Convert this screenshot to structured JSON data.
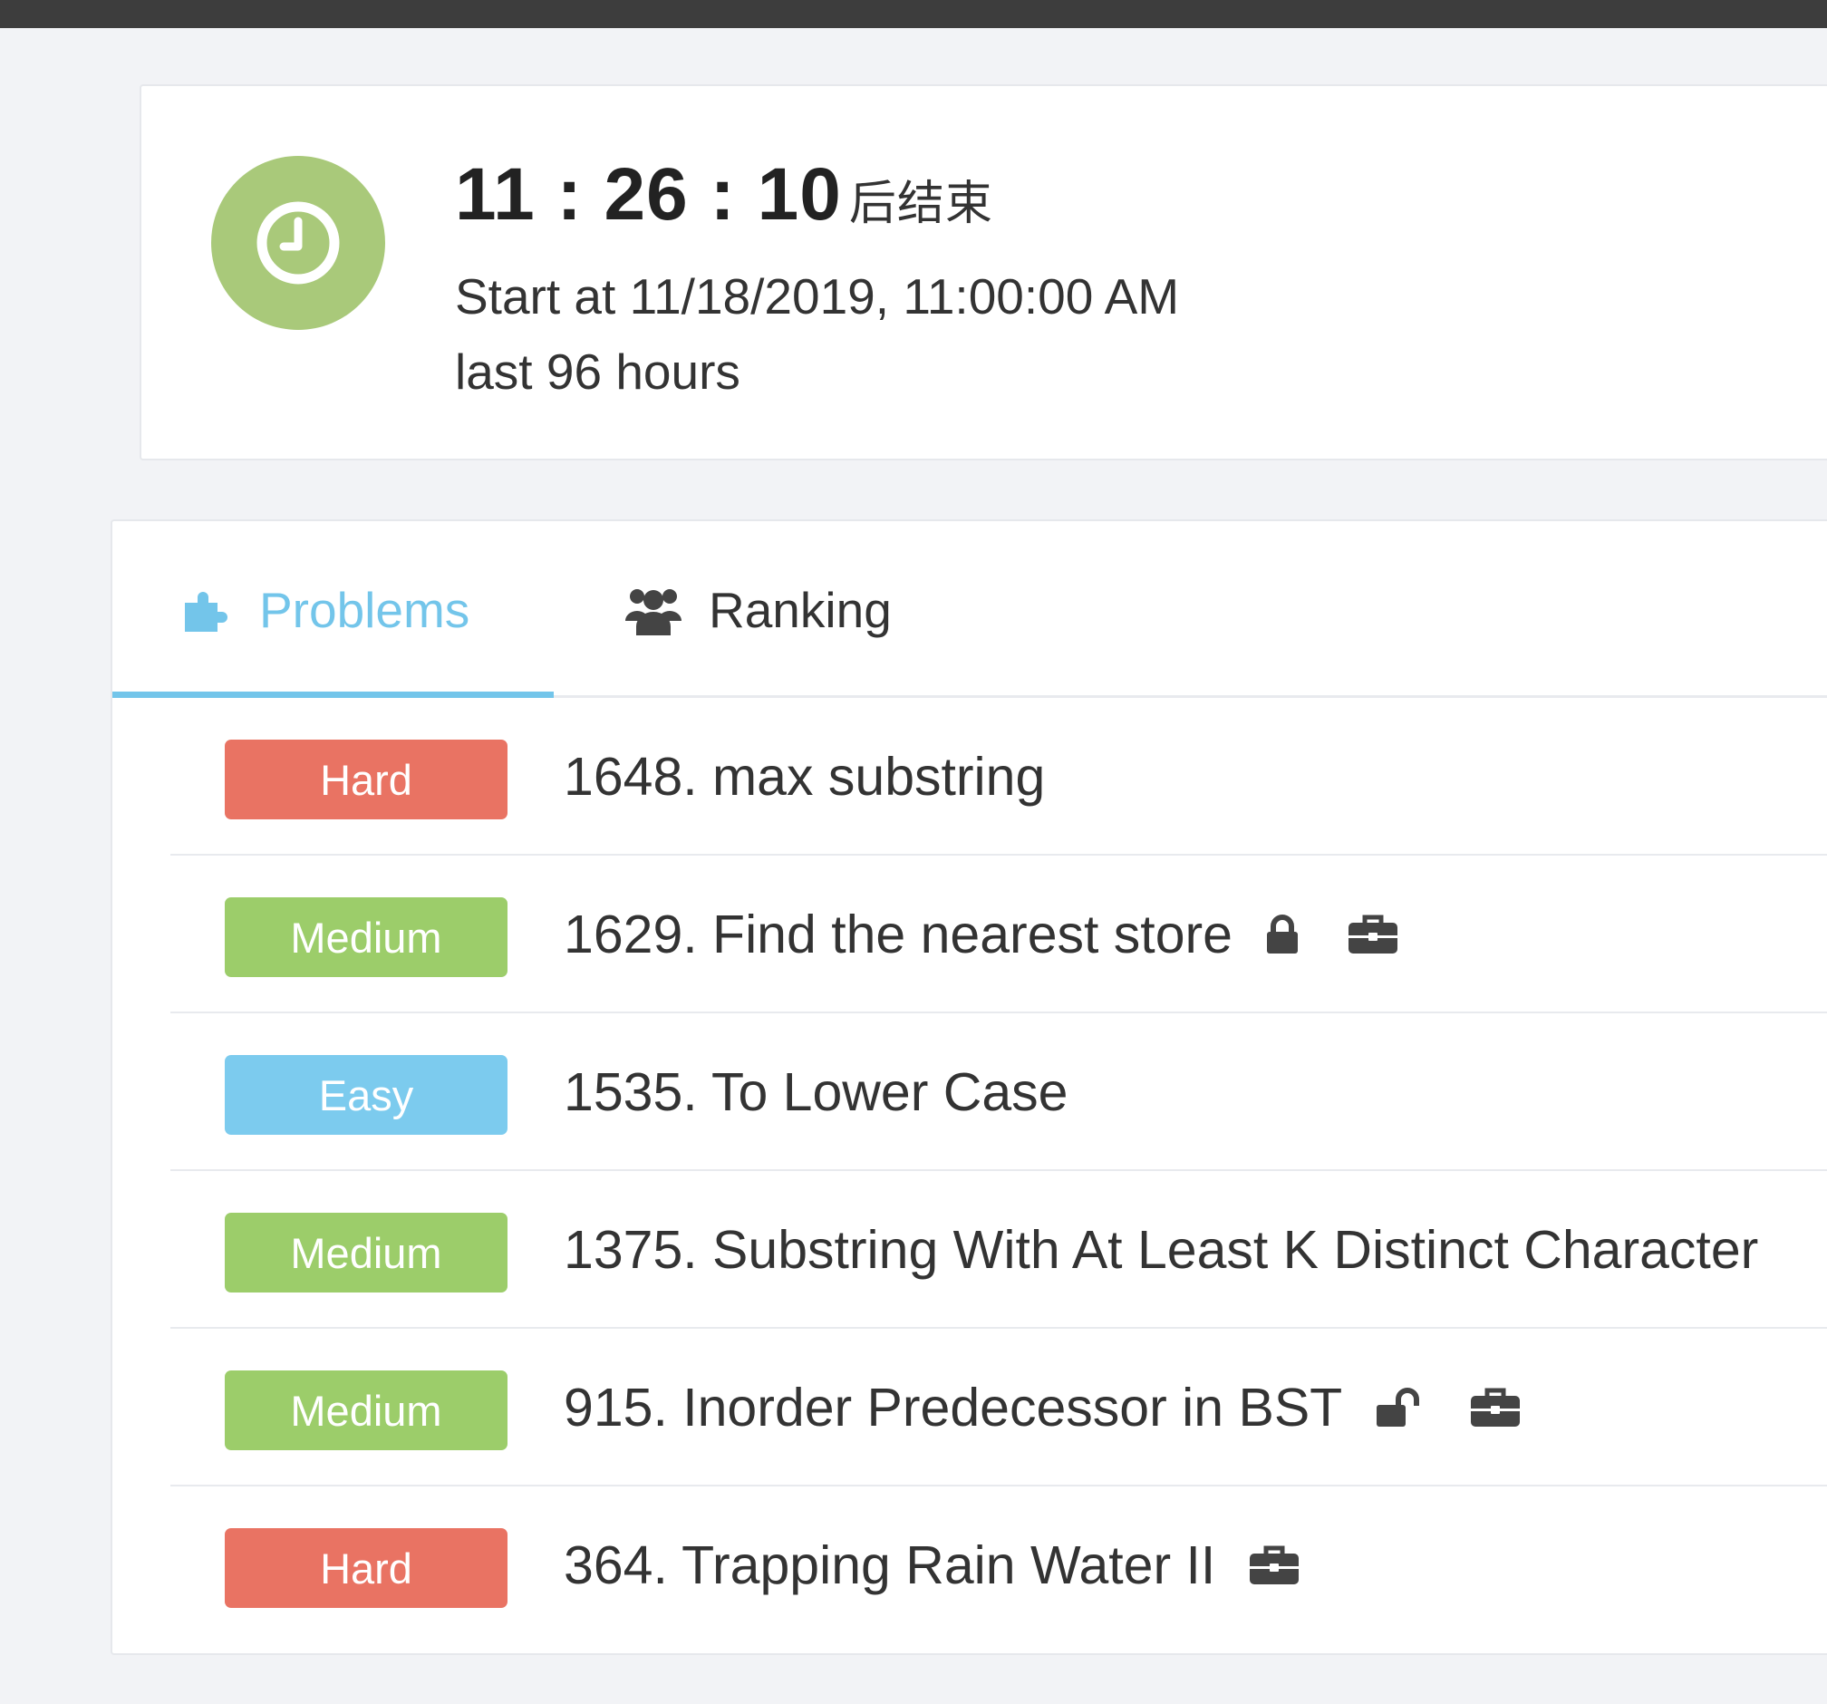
{
  "timer": {
    "countdown": "11 : 26 : 10",
    "suffix": "后结束",
    "start_at": "Start at 11/18/2019, 11:00:00 AM",
    "duration": "last 96 hours"
  },
  "tabs": [
    {
      "label": "Problems",
      "icon": "puzzle-icon",
      "active": true
    },
    {
      "label": "Ranking",
      "icon": "users-icon",
      "active": false
    }
  ],
  "problems": [
    {
      "difficulty": "Hard",
      "title": "1648. max substring",
      "icons": []
    },
    {
      "difficulty": "Medium",
      "title": "1629. Find the nearest store",
      "icons": [
        "lock-icon",
        "briefcase-icon"
      ]
    },
    {
      "difficulty": "Easy",
      "title": "1535. To Lower Case",
      "icons": []
    },
    {
      "difficulty": "Medium",
      "title": "1375. Substring With At Least K Distinct Character",
      "icons": []
    },
    {
      "difficulty": "Medium",
      "title": "915. Inorder Predecessor in BST",
      "icons": [
        "unlock-icon",
        "briefcase-icon"
      ]
    },
    {
      "difficulty": "Hard",
      "title": "364. Trapping Rain Water II",
      "icons": [
        "briefcase-icon"
      ]
    }
  ],
  "colors": {
    "Hard": "#e97363",
    "Medium": "#9ccd6a",
    "Easy": "#7ccbee",
    "accent": "#73c5ea",
    "clock": "#a9c97a"
  }
}
